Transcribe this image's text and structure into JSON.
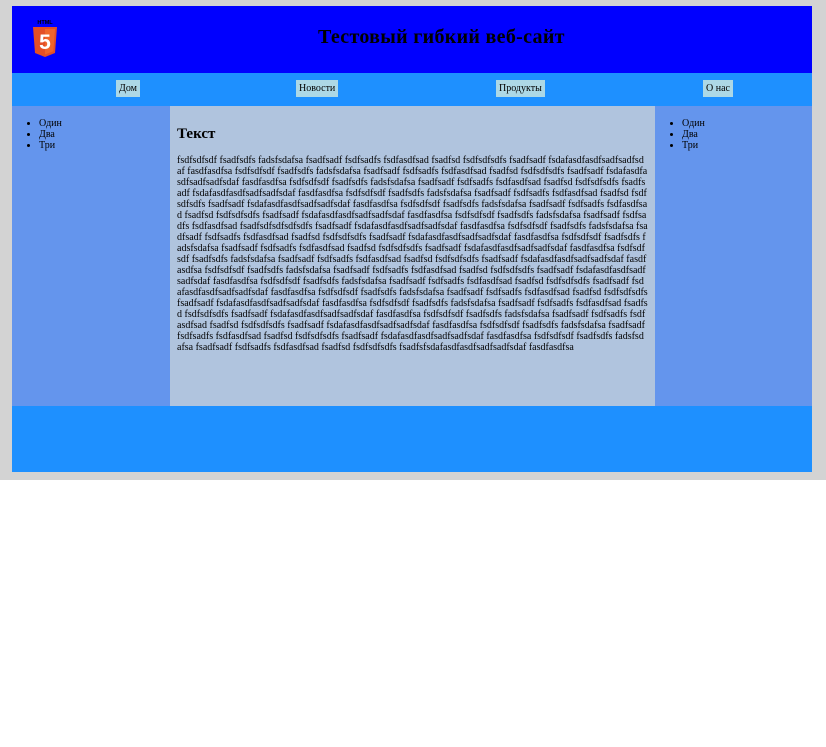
{
  "header": {
    "logo_text": "HTML",
    "logo_digit": "5",
    "title": "Тестовый гибкий веб-сайт"
  },
  "nav": {
    "items": [
      {
        "label": "Дом"
      },
      {
        "label": "Новости"
      },
      {
        "label": "Продукты"
      },
      {
        "label": "О нас"
      }
    ]
  },
  "left_sidebar": {
    "items": [
      "Один",
      "Два",
      "Три"
    ]
  },
  "main": {
    "heading": "Текст",
    "body": "fsdfsdfsdf fsadfsdfs fadsfsdafsa fsadfsadf fsdfsadfs fsdfasdfsad fsadfsd fsdfsdfsdfs fsadfsadf fsdafasdfasdfsadfsadfsdaf fasdfasdfsa fsdfsdfsdf fsadfsdfs fadsfsdafsa fsadfsadf fsdfsadfs fsdfasdfsad fsadfsd fsdfsdfsdfs fsadfsadf fsdafasdfasdfsadfsadfsdaf fasdfasdfsa fsdfsdfsdf fsadfsdfs fadsfsdafsa fsadfsadf fsdfsadfs fsdfasdfsad fsadfsd fsdfsdfsdfs fsadfsadf fsdafasdfasdfsadfsadfsdaf fasdfasdfsa fsdfsdfsdf fsadfsdfs fadsfsdafsa fsadfsadf fsdfsadfs fsdfasdfsad fsadfsd fsdfsdfsdfs fsadfsadf fsdafasdfasdfsadfsadfsdaf fasdfasdfsa fsdfsdfsdf fsadfsdfs fadsfsdafsa fsadfsadf fsdfsadfs fsdfasdfsad fsadfsd fsdfsdfsdfs fsadfsadf fsdafasdfasdfsadfsadfsdaf fasdfasdfsa fsdfsdfsdf fsadfsdfs fadsfsdafsa fsadfsadf fsdfsadfs fsdfasdfsad fsadfsdfsdfsdfsdfs fsadfsadf fsdafasdfasdfsadfsadfsdaf fasdfasdfsa fsdfsdfsdf fsadfsdfs fadsfsdafsa fsadfsadf fsdfsadfs fsdfasdfsad fsadfsd fsdfsdfsdfs fsadfsadf fsdafasdfasdfsadfsadfsdaf fasdfasdfsa fsdfsdfsdf fsadfsdfs fadsfsdafsa fsadfsadf fsdfsadfs fsdfasdfsad fsadfsd fsdfsdfsdfs fsadfsadf fsdafasdfasdfsadfsadfsdaf fasdfasdfsa fsdfsdfsdf fsadfsdfs fadsfsdafsa fsadfsadf fsdfsadfs fsdfasdfsad fsadfsd fsdfsdfsdfs fsadfsadf fsdafasdfasdfsadfsadfsdaf fasdfasdfsa fsdfsdfsdf fsadfsdfs fadsfsdafsa fsadfsadf fsdfsadfs fsdfasdfsad fsadfsd fsdfsdfsdfs fsadfsadf fsdafasdfasdfsadfsadfsdaf fasdfasdfsa fsdfsdfsdf fsadfsdfs fadsfsdafsa fsadfsadf fsdfsadfs fsdfasdfsad fsadfsd fsdfsdfsdfs fsadfsadf fsdafasdfasdfsadfsadfsdaf fasdfasdfsa fsdfsdfsdf fsadfsdfs fadsfsdafsa fsadfsadf fsdfsadfs fsdfasdfsad fsadfsd fsdfsdfsdfs fsadfsadf fsdafasdfasdfsadfsadfsdaf fasdfasdfsa fsdfsdfsdf fsadfsdfs fadsfsdafsa fsadfsadf fsdfsadfs fsdfasdfsad fsadfsd fsdfsdfsdfs fsadfsadf fsdafasdfasdfsadfsadfsdaf fasdfasdfsa fsdfsdfsdf fsadfsdfs fadsfsdafsa fsadfsadf fsdfsadfs fsdfasdfsad fsadfsd fsdfsdfsdfs fsadfsadf fsdafasdfasdfsadfsadfsdaf fasdfasdfsa fsdfsdfsdf fsadfsdfs fadsfsdafsa fsadfsadf fsdfsadfs fsdfasdfsad fsadfsd fsdfsdfsdfs fsadfsadf fsdafasdfasdfsadfsadfsdaf fasdfasdfsa fsdfsdfsdf fsadfsdfs fadsfsdafsa fsadfsadf fsdfsadfs fsdfasdfsad fsadfsd fsdfsdfsdfs fsadfsfsdafasdfasdfsadfsadfsdaf fasdfasdfsa"
  },
  "right_sidebar": {
    "items": [
      "Один",
      "Два",
      "Три"
    ]
  }
}
